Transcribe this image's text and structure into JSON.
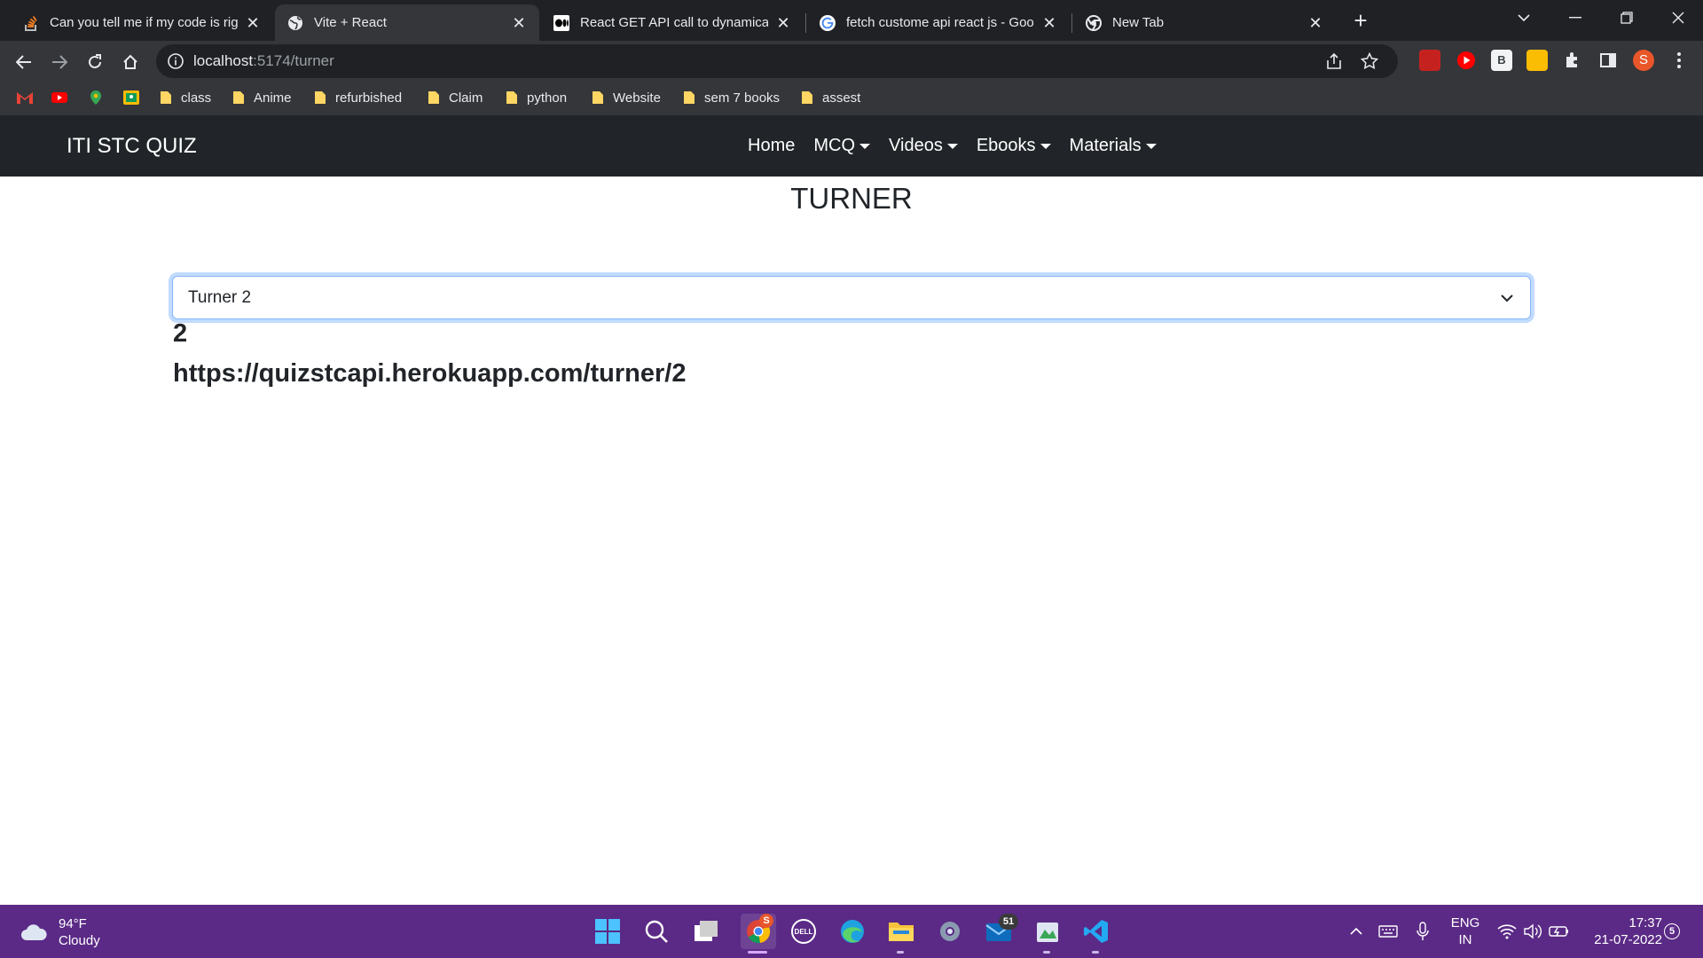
{
  "browser": {
    "tabs": [
      {
        "title": "Can you tell me if my code is right",
        "favicon": "stackoverflow-icon",
        "active": false
      },
      {
        "title": "Vite + React",
        "favicon": "globe-icon",
        "active": true
      },
      {
        "title": "React GET API call to dynamically",
        "favicon": "medium-icon",
        "active": false
      },
      {
        "title": "fetch custome api react js - Goog",
        "favicon": "google-icon",
        "active": false
      },
      {
        "title": "New Tab",
        "favicon": "chrome-icon",
        "active": false
      }
    ],
    "address": {
      "host": "localhost",
      "path": ":5174/turner"
    },
    "profile_initial": "S",
    "bookmarks": [
      "class",
      "Anime",
      "refurbished",
      "Claim",
      "python",
      "Website",
      "sem 7 books",
      "assest"
    ]
  },
  "app": {
    "brand": "ITI STC QUIZ",
    "nav": {
      "home": "Home",
      "mcq": "MCQ",
      "videos": "Videos",
      "ebooks": "Ebooks",
      "materials": "Materials"
    },
    "page_title": "TURNER",
    "select": {
      "selected": "Turner 2"
    },
    "result": {
      "id": "2",
      "url": "https://quizstcapi.herokuapp.com/turner/2"
    }
  },
  "taskbar": {
    "weather": {
      "temp": "94°F",
      "condition": "Cloudy"
    },
    "mail_badge": "51",
    "chrome_badge": "S",
    "language": {
      "line1": "ENG",
      "line2": "IN"
    },
    "clock": {
      "time": "17:37",
      "date": "21-07-2022"
    },
    "notification_count": "5"
  },
  "colors": {
    "navbar": "#212529",
    "taskbar": "#5b2a86",
    "focus_ring": "#86b7fe"
  }
}
